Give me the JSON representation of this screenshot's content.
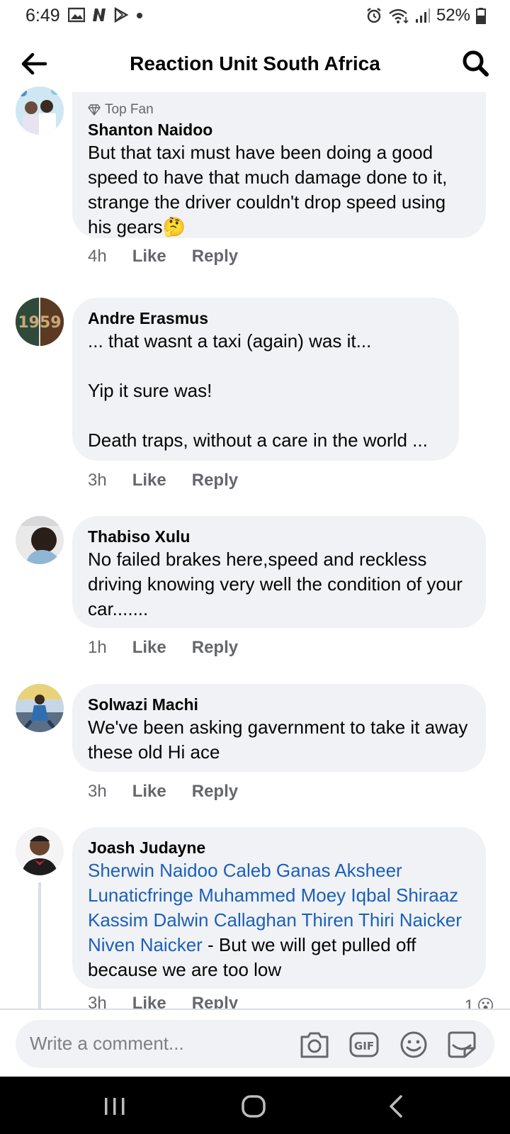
{
  "status_bar": {
    "time": "6:49",
    "battery": "52%",
    "left_icons": [
      "gallery-icon",
      "netflix-icon",
      "play-store-icon",
      "dot-icon"
    ],
    "right_icons": [
      "alarm-icon",
      "wifi-icon",
      "signal-icon",
      "battery-icon"
    ]
  },
  "header": {
    "title": "Reaction Unit South Africa",
    "back_icon": "arrow-left-icon",
    "search_icon": "search-icon"
  },
  "comments": [
    {
      "badge": "Top Fan",
      "author": "Shanton Naidoo",
      "text": "But that taxi must have been doing a good speed to have that much damage done to it, strange the driver couldn't drop speed using his gears🤔",
      "time": "4h",
      "like": "Like",
      "reply": "Reply"
    },
    {
      "author": "Andre Erasmus",
      "text": "... that wasnt a taxi (again) was it...\n\nYip it sure was!\n\nDeath traps, without a care in the world ...",
      "avatar_text": "1959",
      "time": "3h",
      "like": "Like",
      "reply": "Reply"
    },
    {
      "author": "Thabiso Xulu",
      "text": "No failed brakes here,speed and reckless driving knowing very well the condition of your car.......",
      "time": "1h",
      "like": "Like",
      "reply": "Reply"
    },
    {
      "author": "Solwazi Machi",
      "text": "We've been asking gavernment to take it away  these old Hi ace",
      "time": "3h",
      "like": "Like",
      "reply": "Reply"
    },
    {
      "author": "Joash Judayne",
      "mentions": "Sherwin Naidoo Caleb Ganas Aksheer Lunaticfringe Muhammed Moey Iqbal Shiraaz Kassim Dalwin Callaghan Thiren Thiri Naicker Niven Naicker",
      "text": " - But we will get pulled off because we are too low",
      "time": "3h",
      "like": "Like",
      "reply": "Reply",
      "reaction_count": "1",
      "reaction": "😮"
    }
  ],
  "composer": {
    "placeholder": "Write a comment...",
    "icons": [
      "camera-icon",
      "gif-icon",
      "emoji-icon",
      "sticker-icon"
    ],
    "gif_label": "GIF"
  },
  "navbar": {
    "icons": [
      "recent-apps-icon",
      "home-icon",
      "back-icon"
    ]
  },
  "colors": {
    "bubble": "#f0f2f5",
    "mention": "#1b5fba",
    "meta": "#65676b"
  }
}
